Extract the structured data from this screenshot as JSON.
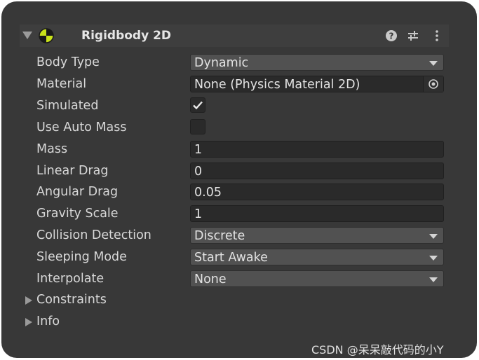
{
  "component": {
    "title": "Rigidbody 2D",
    "icons": [
      "rigidbody-icon",
      "help-icon",
      "preset-icon",
      "context-menu-icon"
    ]
  },
  "fields": {
    "body_type": {
      "label": "Body Type",
      "value": "Dynamic"
    },
    "material": {
      "label": "Material",
      "value": "None (Physics Material 2D)"
    },
    "simulated": {
      "label": "Simulated",
      "checked": true
    },
    "use_auto_mass": {
      "label": "Use Auto Mass",
      "checked": false
    },
    "mass": {
      "label": "Mass",
      "value": "1"
    },
    "linear_drag": {
      "label": "Linear Drag",
      "value": "0"
    },
    "angular_drag": {
      "label": "Angular Drag",
      "value": "0.05"
    },
    "gravity_scale": {
      "label": "Gravity Scale",
      "value": "1"
    },
    "collision_detection": {
      "label": "Collision Detection",
      "value": "Discrete"
    },
    "sleeping_mode": {
      "label": "Sleeping Mode",
      "value": "Start Awake"
    },
    "interpolate": {
      "label": "Interpolate",
      "value": "None"
    }
  },
  "foldouts": {
    "constraints": "Constraints",
    "info": "Info"
  },
  "watermark": "CSDN @呆呆敲代码的小Y",
  "colors": {
    "panel_bg": "#383838",
    "header_bg": "#3e3e3e",
    "dropdown_bg": "#515151",
    "input_bg": "#2a2a2a",
    "text": "#d8d8d8"
  }
}
